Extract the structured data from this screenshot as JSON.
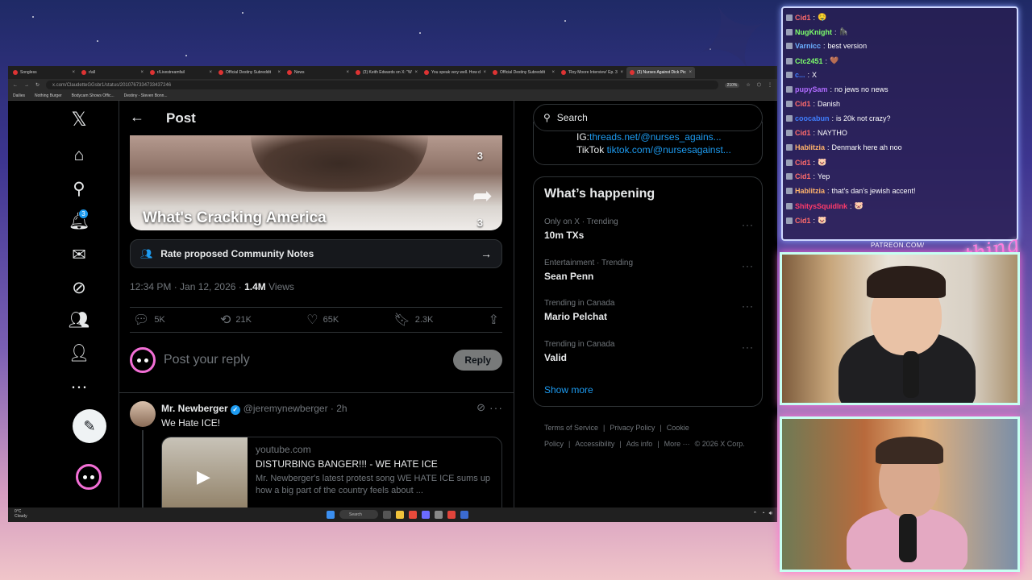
{
  "browser": {
    "tabs": [
      {
        "label": "Songless",
        "active": false
      },
      {
        "label": "r/all",
        "active": false
      },
      {
        "label": "r/Livestreamfail",
        "active": false
      },
      {
        "label": "Official Destiny Subreddit",
        "active": false
      },
      {
        "label": "News",
        "active": false
      },
      {
        "label": "(3) Keith Edwards on X: \"WE ARE...",
        "active": false
      },
      {
        "label": "You speak very well. How do you...",
        "active": false
      },
      {
        "label": "Official Destiny Subreddit",
        "active": false
      },
      {
        "label": "'Roy Moore Interview' Ep. 3 OH...",
        "active": false
      },
      {
        "label": "(3) Nurses Against Dick Pics...",
        "active": true
      }
    ],
    "url": "x.com/ClaudetteGGsbr1/status/2010767334733437246",
    "zoom": "210%",
    "bookmarks": [
      "Dailies",
      "Nothing Burger",
      "Bodycam Shows Offic...",
      "Destiny - Steven Bonn..."
    ]
  },
  "nav": {
    "notifications_badge": "3",
    "icons": [
      "x-logo-icon",
      "home-icon",
      "search-icon",
      "notifications-icon",
      "messages-icon",
      "grok-icon",
      "communities-icon",
      "profile-icon",
      "more-icon"
    ]
  },
  "post": {
    "header_title": "Post",
    "video_caption": "What's Cracking America",
    "video_count_top": "3",
    "video_count_share": "3",
    "community_notes_label": "Rate proposed Community Notes",
    "time": "12:34 PM · Jan 12, 2026 · ",
    "views_count": "1.4M",
    "views_label": " Views",
    "replies": "5K",
    "reposts": "21K",
    "likes": "65K",
    "bookmarks": "2.3K",
    "reply_placeholder": "Post your reply",
    "reply_button": "Reply"
  },
  "reply_tweet": {
    "name": "Mr. Newberger",
    "handle": "@jeremynewberger · 2h",
    "text": "We Hate ICE!",
    "card_domain": "youtube.com",
    "card_title": "DISTURBING BANGER!!! - WE HATE ICE",
    "card_desc": "Mr. Newberger's latest protest song WE HATE ICE sums up how a big part of the country feels about ..."
  },
  "sidebar": {
    "search_placeholder": "Search",
    "link1_prefix": "IG:",
    "link1_url": "threads.net/@nurses_agains...",
    "link2_prefix": "TikTok ",
    "link2_url": "tiktok.com/@nursesagainst...",
    "happening_title": "What’s happening",
    "trends": [
      {
        "context": "Only on X · Trending",
        "name": "10m TXs"
      },
      {
        "context": "Entertainment · Trending",
        "name": "Sean Penn"
      },
      {
        "context": "Trending in Canada",
        "name": "Mario Pelchat"
      },
      {
        "context": "Trending in Canada",
        "name": "Valid"
      }
    ],
    "show_more": "Show more",
    "footer": [
      "Terms of Service",
      "|",
      "Privacy Policy",
      "|",
      "Cookie Policy",
      "|",
      "Accessibility",
      "|",
      "Ads info",
      "|",
      "More ···",
      "© 2026 X Corp."
    ]
  },
  "taskbar": {
    "weather_temp": "0°C",
    "weather_desc": "Cloudy",
    "search_label": "Search"
  },
  "chat": {
    "messages": [
      {
        "user": "Cid1",
        "text": "🤤",
        "color": "#ff6b6b"
      },
      {
        "user": "NugKnight",
        "text": "🦍",
        "color": "#7dff6b"
      },
      {
        "user": "Varnicc",
        "text": "best version",
        "color": "#6bb0ff"
      },
      {
        "user": "Ctc2451",
        "text": "🤎",
        "color": "#7dff6b"
      },
      {
        "user": "c...",
        "text": "X",
        "color": "#3f7fff"
      },
      {
        "user": "pupySam",
        "text": "no jews no news",
        "color": "#b06bff"
      },
      {
        "user": "Cid1",
        "text": "Danish",
        "color": "#ff6b6b"
      },
      {
        "user": "coocabun",
        "text": "is 20k not crazy?",
        "color": "#3f7fff"
      },
      {
        "user": "Cid1",
        "text": "NAYTHO",
        "color": "#ff6b6b"
      },
      {
        "user": "Hablitzia",
        "text": "Denmark here ah noo",
        "color": "#ffb36b"
      },
      {
        "user": "Cid1",
        "text": "🐷",
        "color": "#ff6b6b"
      },
      {
        "user": "Cid1",
        "text": "Yep",
        "color": "#ff6b6b"
      },
      {
        "user": "Hablitzia",
        "text": "that's dan's jewish accent!",
        "color": "#ffb36b"
      },
      {
        "user": "ShitysSquidInk",
        "text": "🐷",
        "color": "#ff3b6b"
      },
      {
        "user": "Cid1",
        "text": "🐷",
        "color": "#ff6b6b"
      }
    ]
  },
  "overlay": {
    "patreon": "PATREON.COM/",
    "signature": "Anything Else?"
  }
}
